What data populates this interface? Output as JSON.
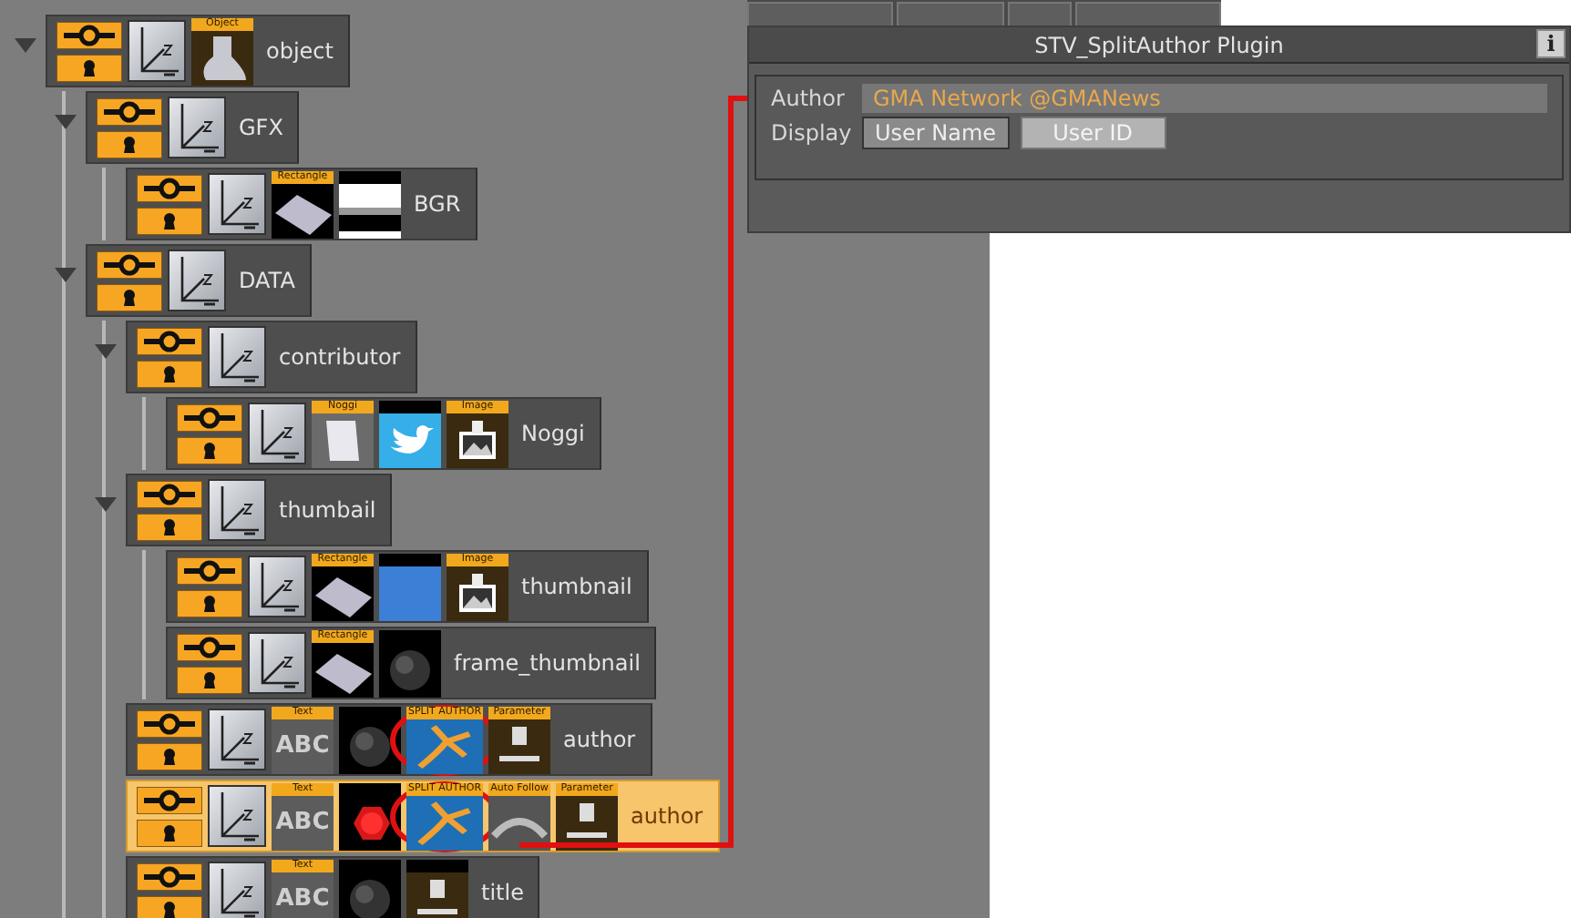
{
  "tree": [
    {
      "name": "object",
      "expanded": true,
      "selected": false,
      "thumbs": [
        {
          "kind": "object",
          "label": "Object"
        }
      ],
      "children": [
        {
          "name": "GFX",
          "expanded": true,
          "selected": false,
          "children": [
            {
              "name": "BGR",
              "selected": false,
              "thumbs": [
                {
                  "kind": "rectangle",
                  "label": "Rectangle"
                },
                {
                  "kind": "gradient"
                }
              ]
            }
          ]
        },
        {
          "name": "DATA",
          "expanded": true,
          "selected": false,
          "children": [
            {
              "name": "contributor",
              "expanded": true,
              "selected": false,
              "children": [
                {
                  "name": "Noggi",
                  "selected": false,
                  "thumbs": [
                    {
                      "kind": "noggi",
                      "label": "Noggi"
                    },
                    {
                      "kind": "bird"
                    },
                    {
                      "kind": "image",
                      "label": "Image"
                    }
                  ]
                }
              ]
            },
            {
              "name": "thumbail",
              "expanded": true,
              "selected": false,
              "children": [
                {
                  "name": "thumbnail",
                  "selected": false,
                  "thumbs": [
                    {
                      "kind": "rectangle",
                      "label": "Rectangle"
                    },
                    {
                      "kind": "photo"
                    },
                    {
                      "kind": "image",
                      "label": "Image"
                    }
                  ]
                },
                {
                  "name": "frame_thumbnail",
                  "selected": false,
                  "thumbs": [
                    {
                      "kind": "rectangle",
                      "label": "Rectangle"
                    },
                    {
                      "kind": "sphere"
                    }
                  ]
                }
              ]
            },
            {
              "name": "author",
              "selected": false,
              "thumbs": [
                {
                  "kind": "text",
                  "label": "Text",
                  "preview": "ABC"
                },
                {
                  "kind": "sphere"
                },
                {
                  "kind": "plugin",
                  "label": "SPLIT AUTHOR",
                  "circled": true
                },
                {
                  "kind": "parameter",
                  "label": "Parameter"
                }
              ]
            },
            {
              "name": "author",
              "selected": true,
              "thumbs": [
                {
                  "kind": "text",
                  "label": "Text",
                  "preview": "ABC"
                },
                {
                  "kind": "hexagon"
                },
                {
                  "kind": "plugin",
                  "label": "SPLIT AUTHOR",
                  "circled": true
                },
                {
                  "kind": "follow",
                  "label": "Auto Follow"
                },
                {
                  "kind": "parameter",
                  "label": "Parameter"
                }
              ]
            },
            {
              "name": "title",
              "selected": false,
              "thumbs": [
                {
                  "kind": "text",
                  "label": "Text",
                  "preview": "ABC"
                },
                {
                  "kind": "sphere"
                },
                {
                  "kind": "parameter"
                }
              ]
            }
          ]
        }
      ]
    }
  ],
  "panel": {
    "title": "STV_SplitAuthor Plugin",
    "info": "i",
    "author": {
      "label": "Author",
      "value": "GMA Network @GMANews"
    },
    "display": {
      "label": "Display",
      "options": [
        {
          "label": "User Name",
          "selected": false
        },
        {
          "label": "User ID",
          "selected": true
        }
      ]
    }
  }
}
